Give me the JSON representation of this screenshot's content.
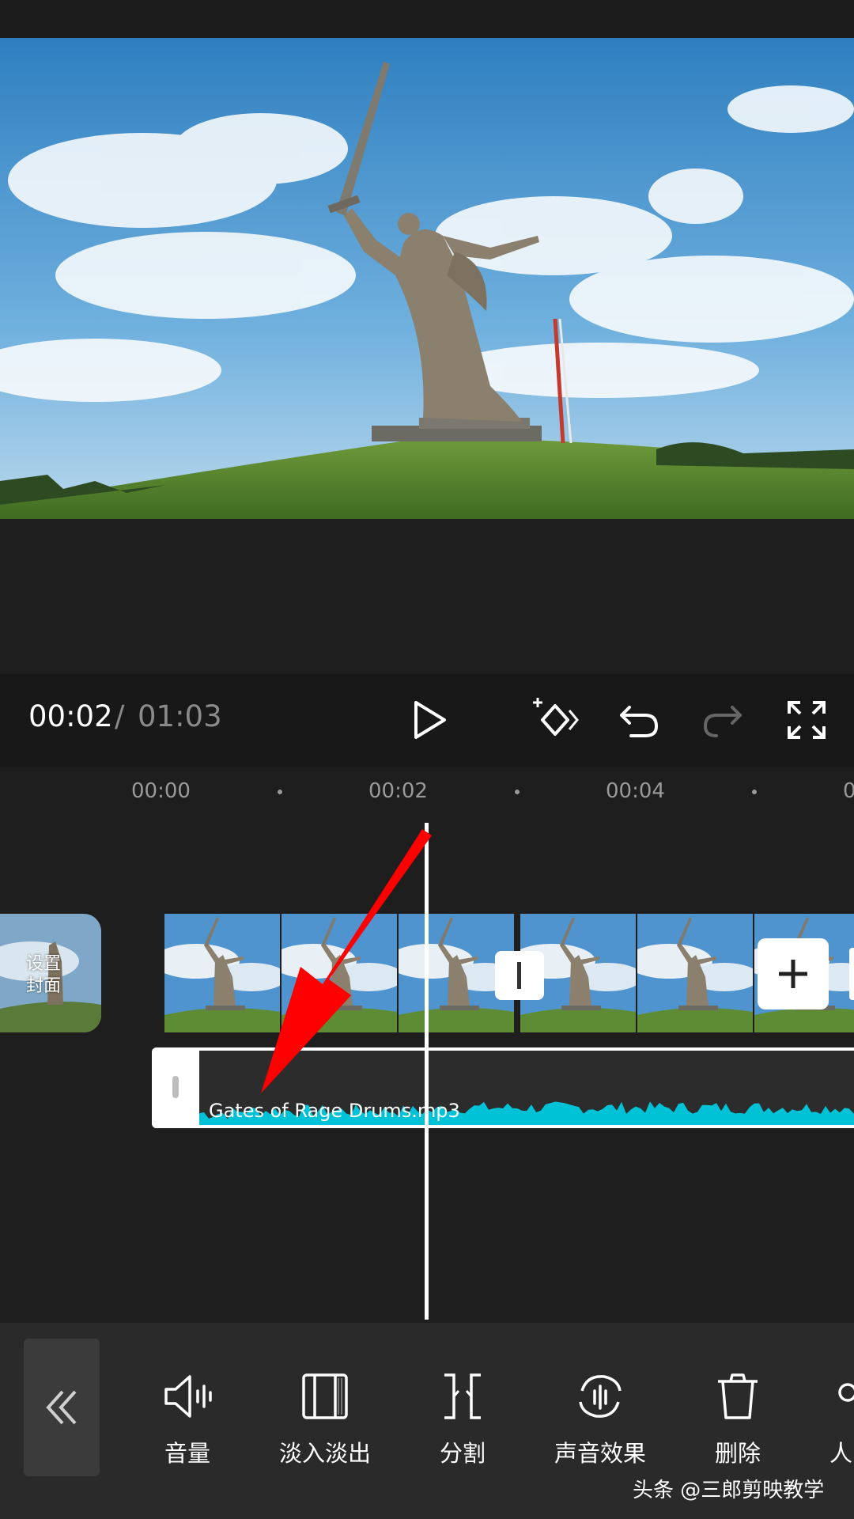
{
  "playback": {
    "current_time": "00:02",
    "separator": "/",
    "total_time": "01:03"
  },
  "controls": [
    {
      "name": "play-icon"
    },
    {
      "name": "keyframe-icon"
    },
    {
      "name": "undo-icon"
    },
    {
      "name": "redo-icon"
    },
    {
      "name": "fullscreen-icon"
    }
  ],
  "ruler": {
    "ticks": [
      "00:00",
      "00:02",
      "00:04",
      "0"
    ]
  },
  "timeline": {
    "cover_label": "设置\n封面",
    "audio_clip_name": "Gates of Rage Drums.mp3"
  },
  "toolbar": {
    "items": [
      {
        "label": "音量",
        "icon": "volume-icon"
      },
      {
        "label": "淡入淡出",
        "icon": "fade-icon"
      },
      {
        "label": "分割",
        "icon": "split-icon"
      },
      {
        "label": "声音效果",
        "icon": "sound-effect-icon"
      },
      {
        "label": "删除",
        "icon": "trash-icon"
      },
      {
        "label": "人",
        "icon": "person-icon"
      }
    ]
  },
  "watermark": "头条 @三郎剪映教学",
  "colors": {
    "waveform": "#00c2d6",
    "arrow": "#ff0000",
    "background": "#1e1e1e"
  }
}
